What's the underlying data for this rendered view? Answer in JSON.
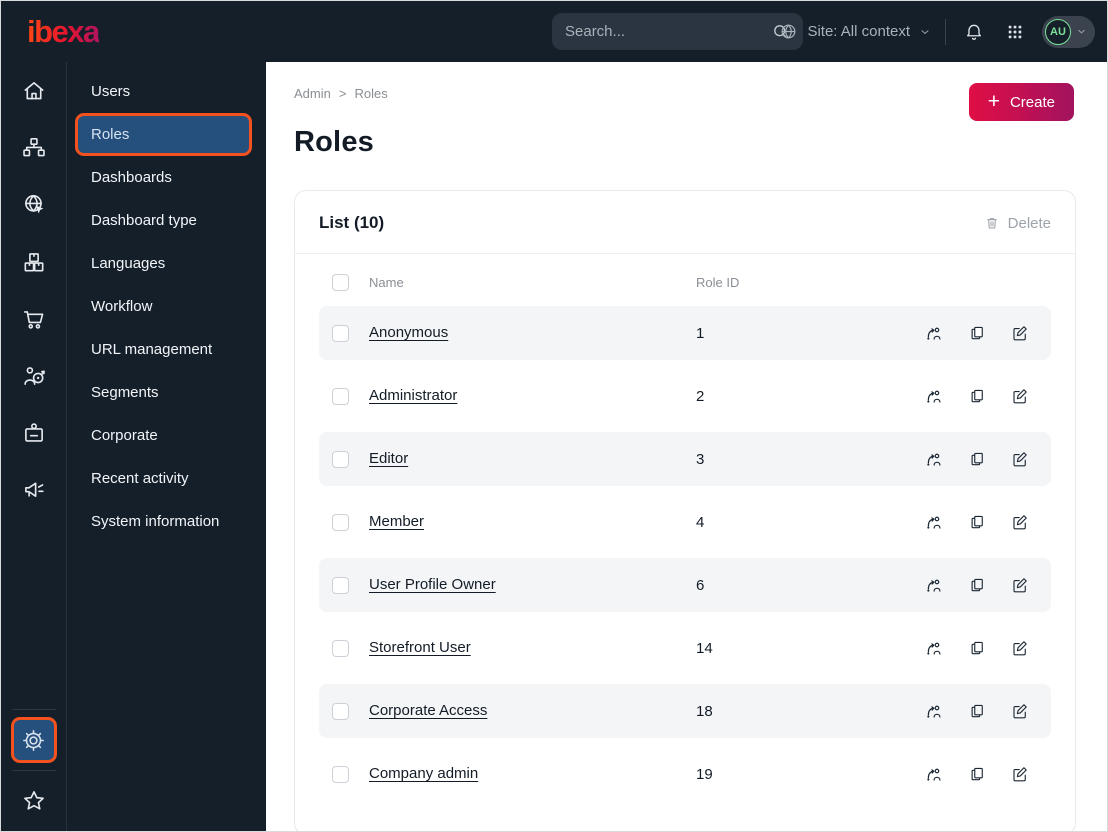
{
  "topbar": {
    "logo_text": "ibexa",
    "search": {
      "placeholder": "Search..."
    },
    "site_selector": {
      "label": "Site: All context"
    },
    "avatar": {
      "initials": "AU"
    }
  },
  "sidebar": {
    "main_icons": [
      "home",
      "content-tree",
      "site",
      "products",
      "commerce",
      "customers",
      "corporate",
      "marketing"
    ],
    "bottom_icons": [
      "admin-settings (active)",
      "bookmarks"
    ]
  },
  "menu": {
    "items": [
      {
        "label": "Users"
      },
      {
        "label": "Roles",
        "active": true
      },
      {
        "label": "Dashboards"
      },
      {
        "label": "Dashboard type"
      },
      {
        "label": "Languages"
      },
      {
        "label": "Workflow"
      },
      {
        "label": "URL management"
      },
      {
        "label": "Segments"
      },
      {
        "label": "Corporate"
      },
      {
        "label": "Recent activity"
      },
      {
        "label": "System information"
      }
    ]
  },
  "main": {
    "breadcrumb": {
      "items": [
        "Admin",
        "Roles"
      ],
      "separator": ">"
    },
    "create_button": "Create",
    "page_title": "Roles",
    "list_card": {
      "title": "List (10)",
      "delete_button": "Delete",
      "columns": {
        "name": "Name",
        "role_id": "Role ID"
      },
      "rows": [
        {
          "name": "Anonymous",
          "role_id": "1"
        },
        {
          "name": "Administrator",
          "role_id": "2"
        },
        {
          "name": "Editor",
          "role_id": "3"
        },
        {
          "name": "Member",
          "role_id": "4"
        },
        {
          "name": "User Profile Owner",
          "role_id": "6"
        },
        {
          "name": "Storefront User",
          "role_id": "14"
        },
        {
          "name": "Corporate Access",
          "role_id": "18"
        },
        {
          "name": "Company admin",
          "role_id": "19"
        }
      ]
    }
  },
  "colors": {
    "topbar_bg": "#151F2A",
    "highlight_border": "#F3511E",
    "active_item_bg": "#25507E",
    "create_gradient_start": "#E00E45",
    "create_gradient_end": "#A2125F",
    "avatar_green": "#7CE097",
    "row_alt_bg": "#F4F5F7",
    "muted_text": "#8A8F95",
    "dark_text": "#131C26"
  }
}
